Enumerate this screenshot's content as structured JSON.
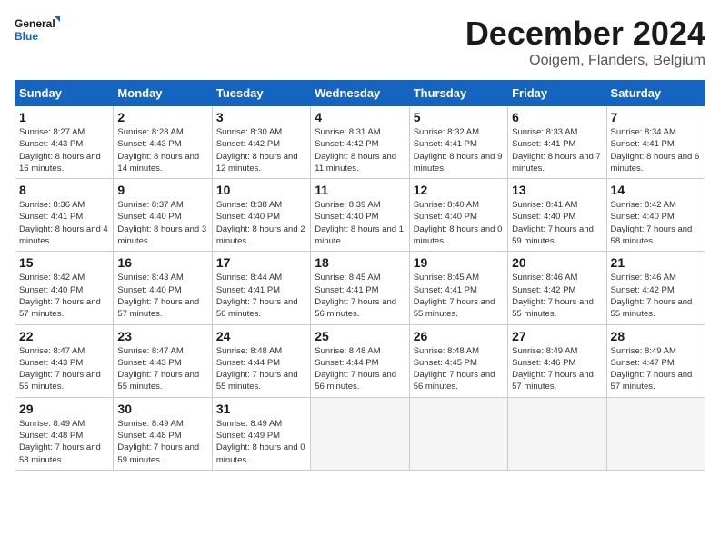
{
  "logo": {
    "text_general": "General",
    "text_blue": "Blue"
  },
  "header": {
    "title": "December 2024",
    "subtitle": "Ooigem, Flanders, Belgium"
  },
  "weekdays": [
    "Sunday",
    "Monday",
    "Tuesday",
    "Wednesday",
    "Thursday",
    "Friday",
    "Saturday"
  ],
  "weeks": [
    [
      {
        "day": "1",
        "sunrise": "8:27 AM",
        "sunset": "4:43 PM",
        "daylight": "8 hours and 16 minutes."
      },
      {
        "day": "2",
        "sunrise": "8:28 AM",
        "sunset": "4:43 PM",
        "daylight": "8 hours and 14 minutes."
      },
      {
        "day": "3",
        "sunrise": "8:30 AM",
        "sunset": "4:42 PM",
        "daylight": "8 hours and 12 minutes."
      },
      {
        "day": "4",
        "sunrise": "8:31 AM",
        "sunset": "4:42 PM",
        "daylight": "8 hours and 11 minutes."
      },
      {
        "day": "5",
        "sunrise": "8:32 AM",
        "sunset": "4:41 PM",
        "daylight": "8 hours and 9 minutes."
      },
      {
        "day": "6",
        "sunrise": "8:33 AM",
        "sunset": "4:41 PM",
        "daylight": "8 hours and 7 minutes."
      },
      {
        "day": "7",
        "sunrise": "8:34 AM",
        "sunset": "4:41 PM",
        "daylight": "8 hours and 6 minutes."
      }
    ],
    [
      {
        "day": "8",
        "sunrise": "8:36 AM",
        "sunset": "4:41 PM",
        "daylight": "8 hours and 4 minutes."
      },
      {
        "day": "9",
        "sunrise": "8:37 AM",
        "sunset": "4:40 PM",
        "daylight": "8 hours and 3 minutes."
      },
      {
        "day": "10",
        "sunrise": "8:38 AM",
        "sunset": "4:40 PM",
        "daylight": "8 hours and 2 minutes."
      },
      {
        "day": "11",
        "sunrise": "8:39 AM",
        "sunset": "4:40 PM",
        "daylight": "8 hours and 1 minute."
      },
      {
        "day": "12",
        "sunrise": "8:40 AM",
        "sunset": "4:40 PM",
        "daylight": "8 hours and 0 minutes."
      },
      {
        "day": "13",
        "sunrise": "8:41 AM",
        "sunset": "4:40 PM",
        "daylight": "7 hours and 59 minutes."
      },
      {
        "day": "14",
        "sunrise": "8:42 AM",
        "sunset": "4:40 PM",
        "daylight": "7 hours and 58 minutes."
      }
    ],
    [
      {
        "day": "15",
        "sunrise": "8:42 AM",
        "sunset": "4:40 PM",
        "daylight": "7 hours and 57 minutes."
      },
      {
        "day": "16",
        "sunrise": "8:43 AM",
        "sunset": "4:40 PM",
        "daylight": "7 hours and 57 minutes."
      },
      {
        "day": "17",
        "sunrise": "8:44 AM",
        "sunset": "4:41 PM",
        "daylight": "7 hours and 56 minutes."
      },
      {
        "day": "18",
        "sunrise": "8:45 AM",
        "sunset": "4:41 PM",
        "daylight": "7 hours and 56 minutes."
      },
      {
        "day": "19",
        "sunrise": "8:45 AM",
        "sunset": "4:41 PM",
        "daylight": "7 hours and 55 minutes."
      },
      {
        "day": "20",
        "sunrise": "8:46 AM",
        "sunset": "4:42 PM",
        "daylight": "7 hours and 55 minutes."
      },
      {
        "day": "21",
        "sunrise": "8:46 AM",
        "sunset": "4:42 PM",
        "daylight": "7 hours and 55 minutes."
      }
    ],
    [
      {
        "day": "22",
        "sunrise": "8:47 AM",
        "sunset": "4:43 PM",
        "daylight": "7 hours and 55 minutes."
      },
      {
        "day": "23",
        "sunrise": "8:47 AM",
        "sunset": "4:43 PM",
        "daylight": "7 hours and 55 minutes."
      },
      {
        "day": "24",
        "sunrise": "8:48 AM",
        "sunset": "4:44 PM",
        "daylight": "7 hours and 55 minutes."
      },
      {
        "day": "25",
        "sunrise": "8:48 AM",
        "sunset": "4:44 PM",
        "daylight": "7 hours and 56 minutes."
      },
      {
        "day": "26",
        "sunrise": "8:48 AM",
        "sunset": "4:45 PM",
        "daylight": "7 hours and 56 minutes."
      },
      {
        "day": "27",
        "sunrise": "8:49 AM",
        "sunset": "4:46 PM",
        "daylight": "7 hours and 57 minutes."
      },
      {
        "day": "28",
        "sunrise": "8:49 AM",
        "sunset": "4:47 PM",
        "daylight": "7 hours and 57 minutes."
      }
    ],
    [
      {
        "day": "29",
        "sunrise": "8:49 AM",
        "sunset": "4:48 PM",
        "daylight": "7 hours and 58 minutes."
      },
      {
        "day": "30",
        "sunrise": "8:49 AM",
        "sunset": "4:48 PM",
        "daylight": "7 hours and 59 minutes."
      },
      {
        "day": "31",
        "sunrise": "8:49 AM",
        "sunset": "4:49 PM",
        "daylight": "8 hours and 0 minutes."
      },
      null,
      null,
      null,
      null
    ]
  ]
}
